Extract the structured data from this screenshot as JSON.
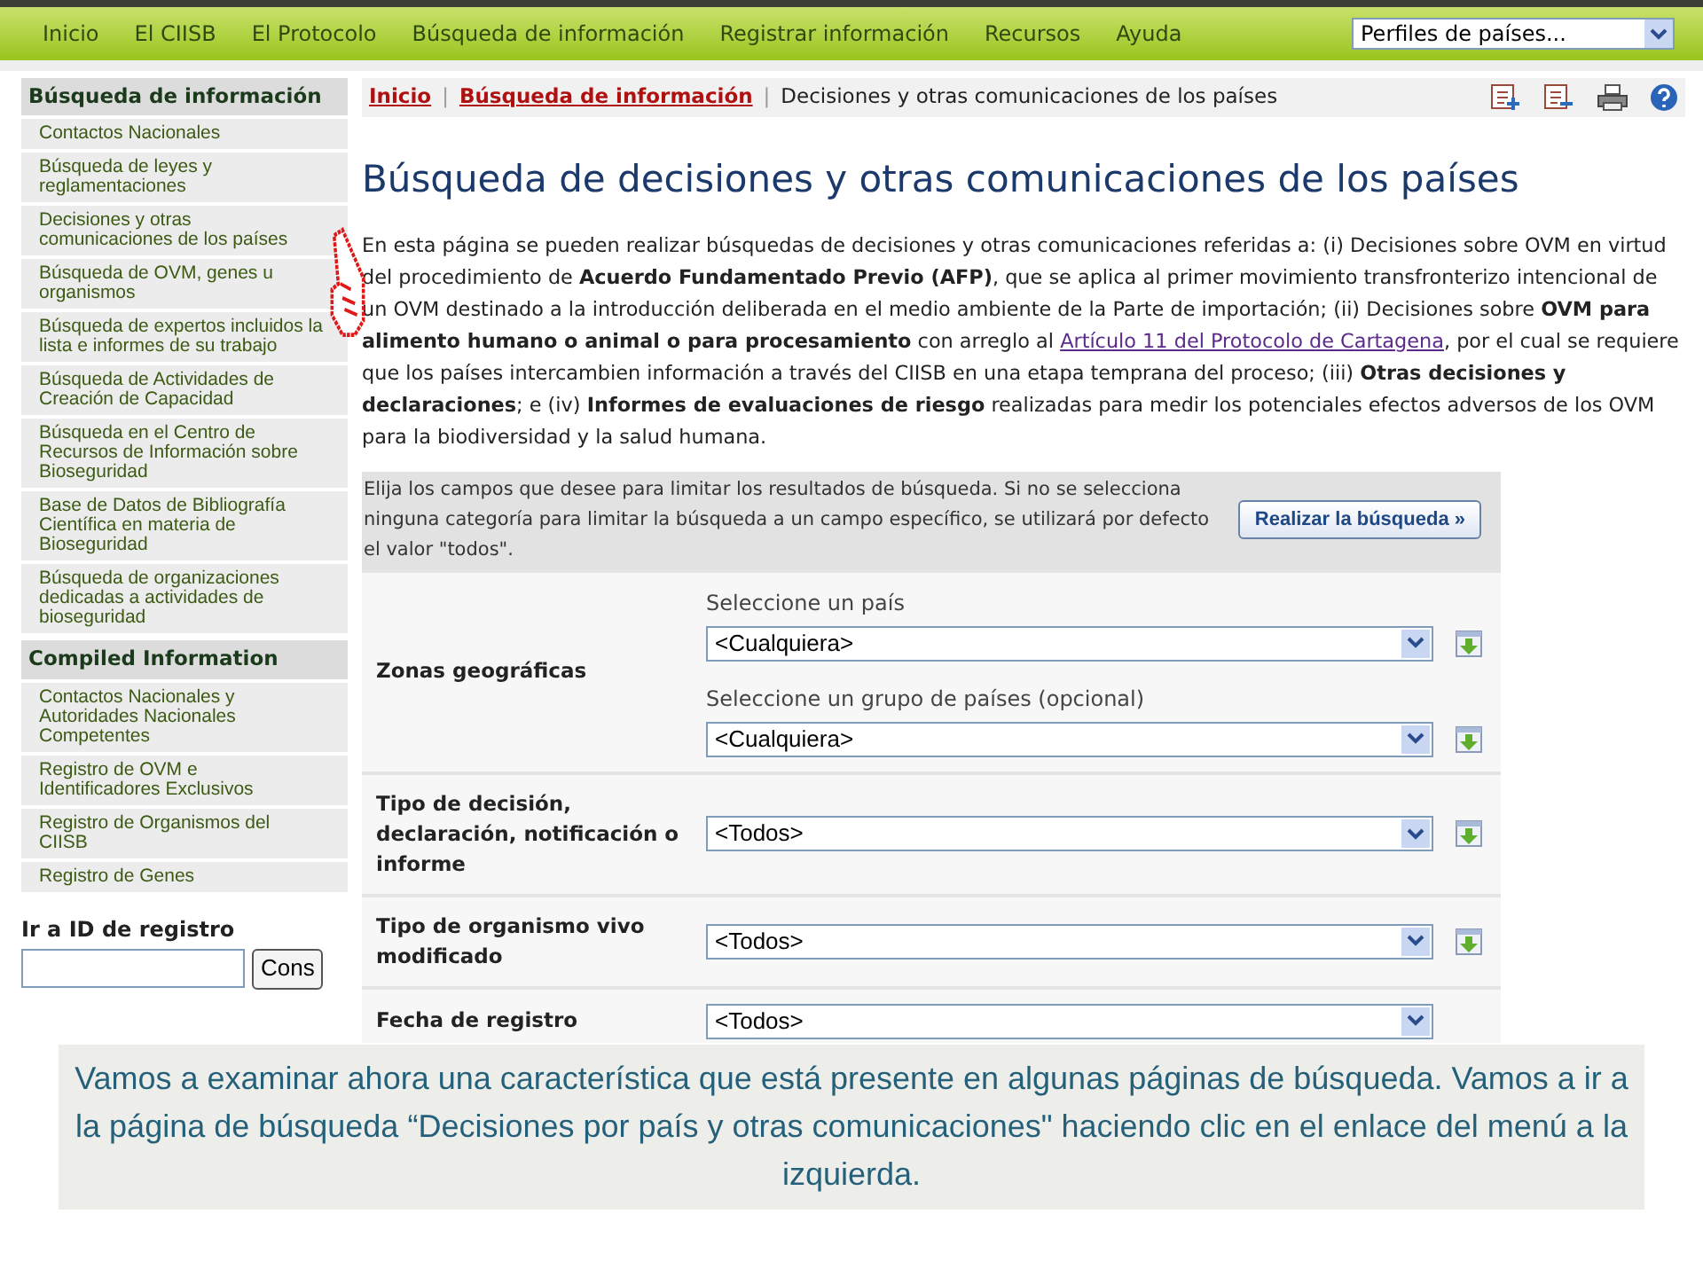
{
  "nav": {
    "items": [
      "Inicio",
      "El CIISB",
      "El Protocolo",
      "Búsqueda de información",
      "Registrar información",
      "Recursos",
      "Ayuda"
    ],
    "profile_select": "Perfiles de países..."
  },
  "sidebar": {
    "sections": [
      {
        "title": "Búsqueda de información",
        "items": [
          "Contactos Nacionales",
          "Búsqueda de leyes y reglamentaciones",
          "Decisiones y otras comunicaciones de los países",
          "Búsqueda de OVM, genes u organismos",
          "Búsqueda de expertos incluidos la lista e informes de su trabajo",
          "Búsqueda de Actividades de Creación de Capacidad",
          "Búsqueda en el Centro de Recursos de Información sobre Bioseguridad",
          "Base de Datos de Bibliografía Científica en materia de Bioseguridad",
          "Búsqueda de organizaciones dedicadas a actividades de bioseguridad"
        ]
      },
      {
        "title": "Compiled Information",
        "items": [
          "Contactos Nacionales y Autoridades Nacionales Competentes",
          "Registro de OVM e Identificadores Exclusivos",
          "Registro de Organismos del CIISB",
          "Registro de Genes"
        ]
      }
    ],
    "goto_label": "Ir a ID de registro",
    "goto_button": "Cons"
  },
  "breadcrumb": {
    "separator": "|",
    "links": [
      "Inicio",
      "Búsqueda de información"
    ],
    "current": "Decisiones y otras comunicaciones de los países"
  },
  "title": "Búsqueda de decisiones y otras comunicaciones de los países",
  "intro": [
    {
      "kind": "plain",
      "text": "En esta página se pueden realizar búsquedas de decisiones y otras comunicaciones referidas a: (i) Decisiones sobre OVM en virtud del procedimiento de "
    },
    {
      "kind": "bold",
      "text": "Acuerdo Fundamentado Previo (AFP)"
    },
    {
      "kind": "plain",
      "text": ", que se aplica al primer movimiento transfronterizo intencional de un OVM destinado a la introducción deliberada en el medio ambiente de la Parte de importación; (ii) Decisiones sobre "
    },
    {
      "kind": "bold",
      "text": "OVM para alimento humano o animal o para procesamiento"
    },
    {
      "kind": "plain",
      "text": " con arreglo al "
    },
    {
      "kind": "link",
      "text": "Artículo 11 del Protocolo de Cartagena"
    },
    {
      "kind": "plain",
      "text": ", por el cual se requiere que los países intercambien información a través del CIISB en una etapa temprana del proceso; (iii) "
    },
    {
      "kind": "bold",
      "text": "Otras decisiones y declaraciones"
    },
    {
      "kind": "plain",
      "text": "; e (iv) "
    },
    {
      "kind": "bold",
      "text": "Informes de evaluaciones de riesgo"
    },
    {
      "kind": "plain",
      "text": " realizadas para medir los potenciales efectos adversos de los OVM para la biodiversidad y la salud humana."
    }
  ],
  "search": {
    "hint": "Elija los campos que desee para limitar los resultados de búsqueda. Si no se selecciona ninguna categoría para limitar la búsqueda a un campo específico, se utilizará por defecto el valor \"todos\".",
    "button": "Realizar la búsqueda »",
    "rows": [
      {
        "label": "Zonas geográficas",
        "selects": [
          {
            "caption": "Seleccione un país",
            "value": "<Cualquiera>",
            "addable": true
          },
          {
            "caption": "Seleccione un grupo de países (opcional)",
            "value": "<Cualquiera>",
            "addable": true
          }
        ]
      },
      {
        "label": "Tipo de decisión, declaración, notificación o informe",
        "selects": [
          {
            "value": "<Todos>",
            "addable": true
          }
        ]
      },
      {
        "label": "Tipo de organismo vivo modificado",
        "selects": [
          {
            "value": "<Todos>",
            "addable": true
          }
        ]
      },
      {
        "label": "Fecha de registro",
        "selects": [
          {
            "value": "<Todos>",
            "addable": false
          }
        ]
      }
    ]
  },
  "caption": "Vamos a examinar ahora una característica que está presente en algunas páginas de búsqueda. Vamos a ir a la página de búsqueda “Decisiones por país y otras comunicaciones\" haciendo clic en el enlace del menú a la izquierda."
}
